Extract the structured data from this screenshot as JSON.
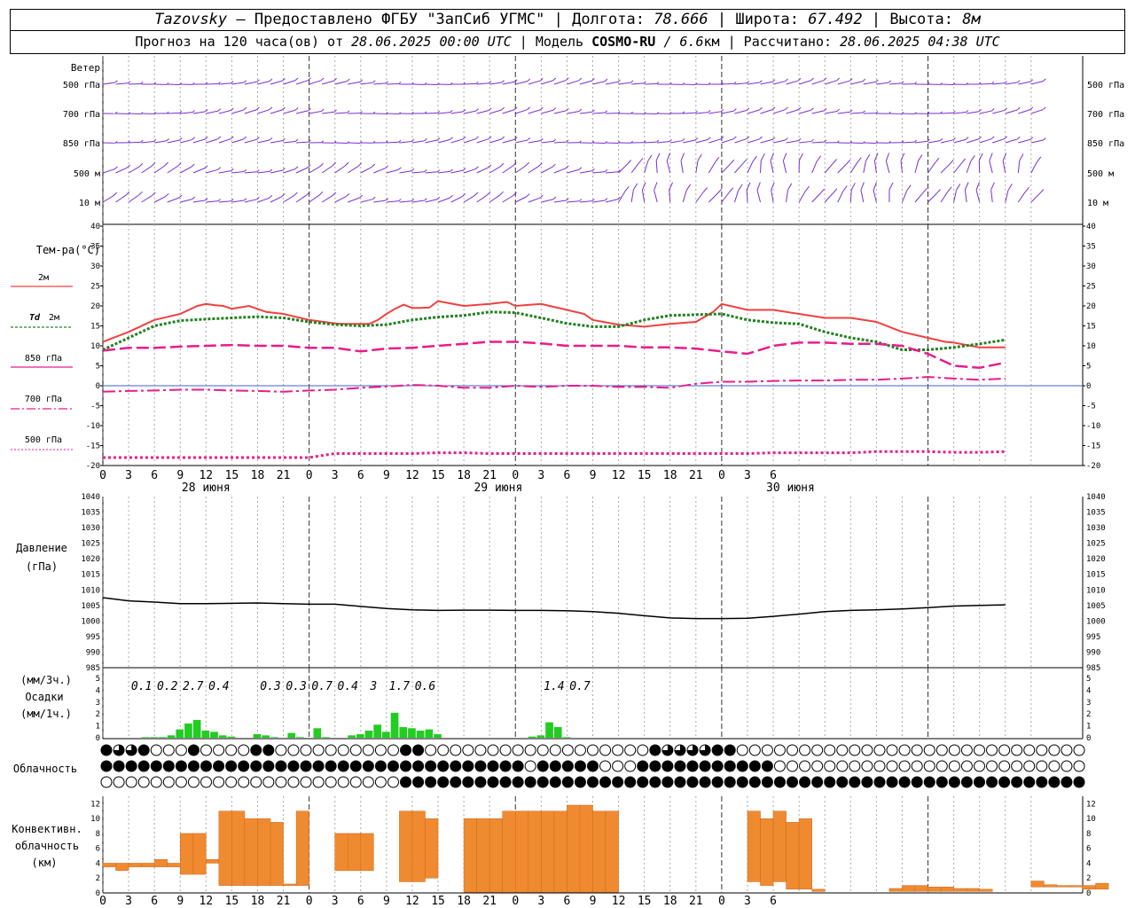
{
  "header": {
    "station": "Tazovsky",
    "provider": " — Предоставлено ФГБУ \"ЗапСиб УГМС\" | Долгота: ",
    "lon": "78.666",
    "lat_label": " | Широта: ",
    "lat": "67.492",
    "alt_label": " | Высота: ",
    "alt": "8м",
    "forecast_prefix": "Прогноз на 120 часа(ов) от ",
    "forecast_date": "28.06.2025 00:00 UTC",
    "model_label": "  | Модель ",
    "model": "COSMO-RU",
    "res": " / 6.6",
    "res_unit": "км",
    "calc_label": " | Рассчитано: ",
    "calc_date": "28.06.2025 04:38 UTC"
  },
  "colors": {
    "wind": "#7a2fd0",
    "t2m": "#f04040",
    "td2m": "#208020",
    "t_levels": "#e81c8c",
    "pressure": "#000000",
    "precip": "#22cc22",
    "conv": "#f08a30"
  },
  "labels": {
    "wind_title": "Ветер",
    "wind_levels": [
      "500 гПа",
      "700 гПа",
      "850 гПа",
      "500 м",
      "10 м"
    ],
    "temp_title": "Тем-ра(°C)",
    "legend_2m": "2м",
    "legend_td_sym": "Td",
    "legend_td": "2м",
    "legend_850": "850 гПа",
    "legend_700": "700 гПа",
    "legend_500": "500 гПа",
    "pressure_title": "Давление",
    "pressure_unit": "(гПа)",
    "precip_unit1": "(мм/3ч.)",
    "precip_title": "Осадки",
    "precip_unit2": "(мм/1ч.)",
    "cloud_title": "Облачность",
    "conv_title1": "Конвективн.",
    "conv_title2": "облачность",
    "conv_unit": "(км)"
  },
  "chart_data": {
    "type": "meteogram",
    "hours": [
      0,
      3,
      6,
      9,
      12,
      15,
      18,
      21,
      0,
      3,
      6,
      9,
      12,
      15,
      18,
      21,
      0,
      3,
      6,
      9,
      12,
      15,
      18,
      21,
      0,
      3,
      6
    ],
    "dates": [
      "28 июня",
      "29 июня",
      "30 июня"
    ],
    "temperature": {
      "ylim": [
        -20,
        40
      ],
      "yticks": [
        -20,
        -15,
        -10,
        -5,
        0,
        5,
        10,
        15,
        20,
        25,
        30,
        35,
        40
      ],
      "series": [
        {
          "key": "t2m",
          "x": [
            0,
            3,
            6,
            8,
            9,
            11,
            12,
            13,
            14,
            15,
            17,
            19,
            21,
            24,
            27,
            28,
            30,
            31,
            32,
            33,
            34,
            35,
            36,
            37,
            38,
            39,
            42,
            45,
            47,
            48,
            51,
            52,
            54,
            56,
            57,
            60,
            63,
            66,
            69,
            71,
            72,
            75,
            78,
            81,
            84,
            87,
            90,
            93,
            96,
            98,
            99,
            102,
            105
          ],
          "values": [
            11,
            13.5,
            16.5,
            17.5,
            18,
            20,
            20.5,
            20.2,
            20,
            19.3,
            20,
            18.5,
            18,
            16.5,
            15.6,
            15.5,
            15.5,
            15.5,
            16.5,
            18,
            19.3,
            20.3,
            19.5,
            19.5,
            19.6,
            21.2,
            20,
            20.5,
            21,
            20,
            20.5,
            20,
            19,
            18,
            16.5,
            15.3,
            14.8,
            15.5,
            16,
            18.5,
            20.5,
            19,
            19,
            18,
            17,
            17,
            16,
            13.5,
            12,
            11,
            10.8,
            9.6,
            9.6,
            9.7,
            12,
            13
          ]
        },
        {
          "key": "td2m",
          "x": [
            0,
            3,
            6,
            9,
            12,
            15,
            18,
            21,
            24,
            27,
            30,
            33,
            36,
            39,
            42,
            45,
            48,
            51,
            54,
            57,
            60,
            63,
            66,
            69,
            72,
            75,
            78,
            81,
            84,
            87,
            90,
            93,
            96,
            99,
            102,
            105
          ],
          "values": [
            9,
            12,
            15,
            16.3,
            16.7,
            17,
            17.3,
            17,
            16,
            15.3,
            15,
            15.3,
            16.5,
            17.2,
            17.6,
            18.5,
            18.3,
            17,
            15.6,
            14.8,
            14.8,
            16.5,
            17.6,
            17.8,
            18,
            16.5,
            15.8,
            15.5,
            13.5,
            12,
            11,
            9,
            9,
            9.6,
            10.5,
            11.5
          ]
        },
        {
          "key": "t850",
          "x": [
            0,
            3,
            6,
            9,
            12,
            15,
            18,
            21,
            24,
            27,
            30,
            33,
            36,
            39,
            42,
            45,
            48,
            51,
            54,
            57,
            60,
            63,
            66,
            69,
            72,
            75,
            78,
            81,
            84,
            87,
            90,
            93,
            96,
            99,
            102,
            105
          ],
          "values": [
            8.8,
            9.5,
            9.5,
            9.8,
            10,
            10.2,
            10,
            10,
            9.5,
            9.5,
            8.6,
            9.3,
            9.5,
            10,
            10.5,
            11,
            11,
            10.6,
            10,
            10,
            10,
            9.6,
            9.6,
            9.3,
            8.6,
            8,
            10,
            10.8,
            10.8,
            10.5,
            10.5,
            10,
            8,
            5,
            4.5,
            5.8
          ]
        },
        {
          "key": "t700",
          "x": [
            0,
            3,
            6,
            9,
            12,
            15,
            18,
            21,
            24,
            27,
            30,
            33,
            36,
            39,
            42,
            45,
            48,
            51,
            54,
            57,
            60,
            63,
            66,
            69,
            72,
            75,
            78,
            81,
            84,
            87,
            90,
            93,
            96,
            99,
            102,
            105
          ],
          "values": [
            -1.5,
            -1.3,
            -1.2,
            -1,
            -1,
            -1.2,
            -1.3,
            -1.5,
            -1.2,
            -1,
            -0.5,
            -0.2,
            0.2,
            0,
            -0.5,
            -0.5,
            0,
            -0.3,
            0,
            0,
            -0.3,
            -0.3,
            -0.5,
            0.5,
            1,
            1,
            1.2,
            1.3,
            1.3,
            1.5,
            1.5,
            1.8,
            2.2,
            1.8,
            1.5,
            1.8
          ]
        },
        {
          "key": "t500",
          "x": [
            0,
            3,
            6,
            9,
            12,
            15,
            18,
            21,
            24,
            27,
            30,
            33,
            36,
            39,
            42,
            45,
            48,
            51,
            54,
            57,
            60,
            63,
            66,
            69,
            72,
            75,
            78,
            81,
            84,
            87,
            90,
            93,
            96,
            99,
            102,
            105
          ],
          "values": [
            -18,
            -18,
            -18,
            -18,
            -18,
            -18,
            -18,
            -18,
            -18,
            -17,
            -17,
            -17,
            -17,
            -16.8,
            -16.8,
            -17,
            -17,
            -17,
            -17,
            -17,
            -17,
            -17,
            -17,
            -17,
            -17,
            -17,
            -16.8,
            -16.8,
            -16.8,
            -16.8,
            -16.5,
            -16.5,
            -16.5,
            -16.7,
            -16.7,
            -16.5
          ]
        }
      ]
    },
    "pressure": {
      "ylim": [
        985,
        1040
      ],
      "yticks": [
        985,
        990,
        995,
        1000,
        1005,
        1010,
        1015,
        1020,
        1025,
        1030,
        1035,
        1040
      ],
      "x": [
        0,
        3,
        6,
        9,
        12,
        15,
        18,
        21,
        24,
        27,
        30,
        33,
        36,
        39,
        42,
        45,
        48,
        51,
        54,
        57,
        60,
        63,
        66,
        69,
        72,
        75,
        78,
        81,
        84,
        87,
        90,
        93,
        96,
        99,
        102,
        105
      ],
      "values": [
        1007.5,
        1006.5,
        1006.1,
        1005.6,
        1005.6,
        1005.7,
        1005.8,
        1005.6,
        1005.4,
        1005.4,
        1004.7,
        1004,
        1003.6,
        1003.4,
        1003.5,
        1003.5,
        1003.4,
        1003.4,
        1003.3,
        1003,
        1002.5,
        1001.7,
        1001,
        1000.8,
        1000.8,
        1000.9,
        1001.5,
        1002.2,
        1003,
        1003.4,
        1003.6,
        1003.9,
        1004.3,
        1004.8,
        1005,
        1005.2
      ]
    },
    "precip": {
      "ylim": [
        0,
        5
      ],
      "yticks": [
        0,
        1,
        2,
        3,
        4,
        5
      ],
      "hourly_x": [
        5,
        6,
        7,
        8,
        9,
        10,
        11,
        12,
        13,
        14,
        15,
        18,
        19,
        20,
        22,
        23,
        25,
        26,
        29,
        30,
        31,
        32,
        33,
        34,
        35,
        36,
        37,
        38,
        39,
        50,
        51,
        52,
        53,
        54
      ],
      "hourly_values": [
        0.05,
        0.05,
        0.05,
        0.2,
        0.7,
        1.2,
        1.5,
        0.6,
        0.5,
        0.2,
        0.1,
        0.3,
        0.2,
        0.05,
        0.4,
        0.05,
        0.8,
        0.05,
        0.2,
        0.3,
        0.6,
        1.1,
        0.5,
        2.1,
        0.9,
        0.8,
        0.6,
        0.7,
        0.3,
        0.1,
        0.2,
        1.3,
        0.9,
        0.05
      ],
      "sum3h_x": [
        4.5,
        7.5,
        10.5,
        13.5,
        19.5,
        22.5,
        25.5,
        28.5,
        31.5,
        34.5,
        37.5,
        52.5,
        55.5
      ],
      "sum3h": [
        "0.1",
        "0.2",
        "2.7",
        "0.4",
        "0.3",
        "0.3",
        "0.7",
        "0.4",
        "3",
        "1.7",
        "0.6",
        "1.4",
        "0.7"
      ]
    },
    "conv": {
      "ylim": [
        0,
        13
      ],
      "yticks": [
        0,
        2,
        4,
        6,
        8,
        10,
        12
      ],
      "bars": [
        {
          "x": 0,
          "base": 3.5,
          "top": 4
        },
        {
          "x": 1,
          "base": 3,
          "top": 4
        },
        {
          "x": 2,
          "base": 3.5,
          "top": 4
        },
        {
          "x": 3,
          "base": 3.5,
          "top": 4
        },
        {
          "x": 4,
          "base": 3.5,
          "top": 4.5
        },
        {
          "x": 5,
          "base": 3.5,
          "top": 4
        },
        {
          "x": 6,
          "base": 2.5,
          "top": 8
        },
        {
          "x": 7,
          "base": 2.5,
          "top": 8
        },
        {
          "x": 8,
          "base": 4,
          "top": 4.5
        },
        {
          "x": 9,
          "base": 1,
          "top": 11
        },
        {
          "x": 10,
          "base": 1,
          "top": 11
        },
        {
          "x": 11,
          "base": 1,
          "top": 10
        },
        {
          "x": 12,
          "base": 1,
          "top": 10
        },
        {
          "x": 13,
          "base": 1,
          "top": 9.5
        },
        {
          "x": 14,
          "base": 1,
          "top": 1.2
        },
        {
          "x": 15,
          "base": 1,
          "top": 11
        },
        {
          "x": 18,
          "base": 3,
          "top": 8
        },
        {
          "x": 19,
          "base": 3,
          "top": 8
        },
        {
          "x": 20,
          "base": 3,
          "top": 8
        },
        {
          "x": 23,
          "base": 1.5,
          "top": 11
        },
        {
          "x": 24,
          "base": 1.5,
          "top": 11
        },
        {
          "x": 25,
          "base": 2,
          "top": 10
        },
        {
          "x": 28,
          "base": 0.1,
          "top": 10
        },
        {
          "x": 29,
          "base": 0.1,
          "top": 10
        },
        {
          "x": 30,
          "base": 0.1,
          "top": 10
        },
        {
          "x": 31,
          "base": 0.1,
          "top": 11
        },
        {
          "x": 32,
          "base": 0.1,
          "top": 11
        },
        {
          "x": 33,
          "base": 0.1,
          "top": 11
        },
        {
          "x": 34,
          "base": 0.1,
          "top": 11
        },
        {
          "x": 35,
          "base": 0.1,
          "top": 11
        },
        {
          "x": 36,
          "base": 0.1,
          "top": 11.8
        },
        {
          "x": 37,
          "base": 0.1,
          "top": 11.8
        },
        {
          "x": 38,
          "base": 0.1,
          "top": 11
        },
        {
          "x": 39,
          "base": 0.1,
          "top": 11
        },
        {
          "x": 50,
          "base": 1.5,
          "top": 11
        },
        {
          "x": 51,
          "base": 1,
          "top": 10
        },
        {
          "x": 52,
          "base": 1.5,
          "top": 11
        },
        {
          "x": 53,
          "base": 0.5,
          "top": 9.5
        },
        {
          "x": 54,
          "base": 0.5,
          "top": 10
        },
        {
          "x": 55,
          "base": 0.2,
          "top": 0.5
        },
        {
          "x": 61,
          "base": 0.2,
          "top": 0.6
        },
        {
          "x": 62,
          "base": 0.2,
          "top": 1
        },
        {
          "x": 63,
          "base": 0.2,
          "top": 1
        },
        {
          "x": 64,
          "base": 0.2,
          "top": 0.8
        },
        {
          "x": 65,
          "base": 0.2,
          "top": 0.8
        },
        {
          "x": 66,
          "base": 0.2,
          "top": 0.6
        },
        {
          "x": 67,
          "base": 0.2,
          "top": 0.6
        },
        {
          "x": 68,
          "base": 0.2,
          "top": 0.5
        },
        {
          "x": 72,
          "base": 0.8,
          "top": 1.6
        },
        {
          "x": 73,
          "base": 0.8,
          "top": 1.1
        },
        {
          "x": 74,
          "base": 0.8,
          "top": 1
        },
        {
          "x": 75,
          "base": 0.8,
          "top": 1
        },
        {
          "x": 76,
          "base": 0.5,
          "top": 1
        },
        {
          "x": 77,
          "base": 0.5,
          "top": 1.3
        }
      ]
    },
    "cloud_rows": {
      "rows": 3,
      "symbols_per_row": 79,
      "levels": [
        "high",
        "mid",
        "low"
      ],
      "cover": [
        "433400040000440000000000440000000000000000004333344000000000000000000000000000000",
        "444444444444444444444444444444444404444400044444444444000000000000000000000000000",
        "000000000000000000000000444444444444444444444444444444444444444444444444444444444"
      ]
    }
  }
}
